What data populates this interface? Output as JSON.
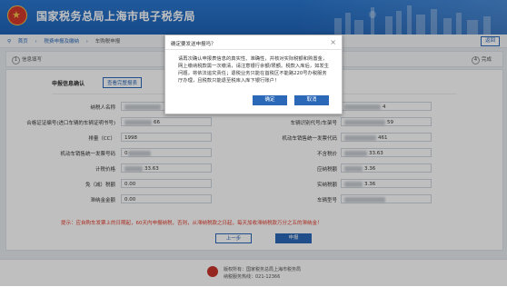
{
  "header": {
    "title": "国家税务总局上海市电子税务局"
  },
  "breadcrumb": {
    "items": [
      "首页",
      "税费申报及缴纳",
      "车购税申报"
    ],
    "back_label": "返回"
  },
  "steps": {
    "items": [
      {
        "num": "1",
        "label": "信息填写"
      },
      {
        "num": "4",
        "label": "完成"
      }
    ]
  },
  "form": {
    "section_title": "申报信息确认",
    "section_link": "查看完整报表",
    "left_fields": [
      {
        "label": "纳税人名称",
        "value": ""
      },
      {
        "label": "合格证证编号(进口车辆的车辆证明书号)",
        "value": "66"
      },
      {
        "label": "排量（CC）",
        "value": "1998"
      },
      {
        "label": "机动车销售统一发票号码",
        "value": "0"
      },
      {
        "label": "计税价格",
        "value": "33.63"
      },
      {
        "label": "免（减）税额",
        "value": "0.00"
      },
      {
        "label": "滞纳金金额",
        "value": "0.00"
      }
    ],
    "right_fields": [
      {
        "label": "",
        "value": "4"
      },
      {
        "label": "车辆识别代号/车架号",
        "value": "59"
      },
      {
        "label": "机动车销售统一发票代码",
        "value": "461"
      },
      {
        "label": "不含税价",
        "value": "33.63"
      },
      {
        "label": "应纳税额",
        "value": "3.36"
      },
      {
        "label": "实纳税额",
        "value": "3.36"
      },
      {
        "label": "车辆型号",
        "value": ""
      }
    ],
    "tip": "提示：应自购车发票上的日期起，60天内申报纳税，否则，从滞纳税款之日起，每天加收滞纳税款万分之五的滞纳金！",
    "prev_label": "上一步",
    "next_label": "申报"
  },
  "footer": {
    "line1": "版权所有：国家税务总局上海市税务局",
    "line2": "纳税服务热线：021-12366"
  },
  "modal": {
    "title": "确定要发送申报吗？",
    "close": "×",
    "body": "请再次确认申报表信息的真实性、准确性，并核对实际税额和购置金，网上缴纳税款需一次缴清，请注意银行余额/限额。税款入库后，如发生问题，将依法追究责任；退税业务只能在首税区不能路220号办税服务厅办理，且税款只能退至税库入库下银行账户！",
    "ok_label": "确定",
    "cancel_label": "取消"
  }
}
